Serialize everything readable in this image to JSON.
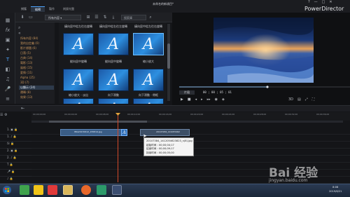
{
  "window": {
    "doc_title": "未命名的新項目*",
    "app_name": "PowerDirector",
    "controls": [
      "?",
      "—",
      "□",
      "✕"
    ]
  },
  "menu": {
    "items": [
      {
        "label": "捕獲",
        "active": false
      },
      {
        "label": "編輯",
        "active": true
      },
      {
        "label": "製作",
        "active": false
      },
      {
        "label": "刻錄光盤",
        "active": false
      }
    ]
  },
  "library": {
    "dropdown_value": "所有內容",
    "search_placeholder": "搜索庫",
    "categories": [
      {
        "label": "所有內容 (84)",
        "selected": false
      },
      {
        "label": "我的自定義 (0)",
        "selected": false
      },
      {
        "label": "影片標題 (6)",
        "selected": false
      },
      {
        "label": "日落 (5)",
        "selected": false
      },
      {
        "label": "古典 (14)",
        "selected": false
      },
      {
        "label": "電影 (13)",
        "selected": false
      },
      {
        "label": "風格 (15)",
        "selected": false
      },
      {
        "label": "愛情 (11)",
        "selected": false
      },
      {
        "label": "Alpha (25)",
        "selected": false
      },
      {
        "label": "3D (7)",
        "selected": false
      },
      {
        "label": "以顯示 (24)",
        "selected": true
      },
      {
        "label": "運轉 (8)",
        "selected": false
      },
      {
        "label": "效果 (13)",
        "selected": false
      }
    ],
    "templates": [
      {
        "label": "橫向居中從左往右旋轉",
        "selected": false
      },
      {
        "label": "橫向居中從右往左旋轉",
        "selected": false
      },
      {
        "label": "橫向居中從左往右旋轉",
        "selected": false
      },
      {
        "label": "縱向居中旋轉",
        "selected": true
      },
      {
        "label": "縱向居中旋轉",
        "selected": false
      },
      {
        "label": "縮小放大",
        "selected": false
      },
      {
        "label": "縮小放大 - 淡出",
        "selected": false
      },
      {
        "label": "向下滑動",
        "selected": false
      },
      {
        "label": "向下滑動 - 帶框",
        "selected": false
      }
    ]
  },
  "preview": {
    "mode_label": "片段",
    "timecode": "00 ; 00 ; 05 ; 01"
  },
  "timeline": {
    "ruler_labels": [
      "00;00;00;00",
      "00;00;04;00",
      "00;00;08;00",
      "00;00;12;00",
      "00;00;16;00",
      "00;00;20;00",
      "00;00;24;00",
      "00;00;28;00",
      "00;00;32;00",
      "00;00;36;00",
      "00;00;40;00"
    ],
    "tracks": [
      "1.",
      "1.",
      "2.",
      "2.",
      "3.",
      "3.",
      "T",
      "♪"
    ],
    "clip1_label": "IMG20170612_155814.jpg",
    "clip2_label": "20107284_141055462"
  },
  "tooltip": {
    "lines": [
      "20107384_1412054623823_n(8).jpg",
      "起始时间 : 00;00;04;17",
      "结束时间 : 00;00;09;17",
      "持续时间 : 00;00;05;00"
    ]
  },
  "taskbar": {
    "time": "8:08",
    "date": "2019/6/21"
  },
  "watermark": {
    "brand": "Bai 经验",
    "url": "jingyan.baidu.com"
  },
  "colors": {
    "accent": "#4ea5ff",
    "playhead": "#d44a2a",
    "category_text": "#c3925a"
  }
}
